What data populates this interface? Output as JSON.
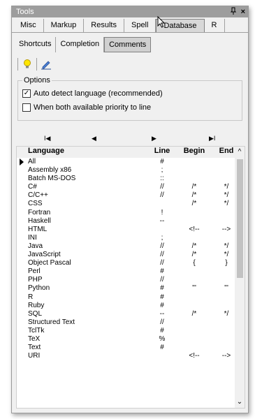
{
  "window": {
    "title": "Tools",
    "pin": "⵽",
    "close": "×"
  },
  "tabs": [
    {
      "label": "Misc",
      "active": false
    },
    {
      "label": "Markup",
      "active": false
    },
    {
      "label": "Results",
      "active": false
    },
    {
      "label": "Spell",
      "active": false
    },
    {
      "label": "Database",
      "active": true
    },
    {
      "label": "R",
      "active": false
    }
  ],
  "subtabs": [
    {
      "label": "Shortcuts",
      "active": false
    },
    {
      "label": "Completion",
      "active": false
    },
    {
      "label": "Comments",
      "active": true
    }
  ],
  "toolbar": {
    "icons": [
      "lightbulb-icon",
      "edit-pencil-icon"
    ]
  },
  "options": {
    "legend": "Options",
    "auto_detect": {
      "label": "Auto detect language (recommended)",
      "checked": true
    },
    "priority_line": {
      "label": "When both available priority to line",
      "checked": false
    }
  },
  "nav": {
    "first": "I◀",
    "prev": "◀",
    "next": "▶",
    "last": "▶I"
  },
  "grid": {
    "headers": {
      "language": "Language",
      "line": "Line",
      "begin": "Begin",
      "end": "End"
    },
    "rows": [
      {
        "language": "All",
        "line": "#",
        "begin": "",
        "end": "",
        "current": true
      },
      {
        "language": "Assembly x86",
        "line": ";",
        "begin": "",
        "end": ""
      },
      {
        "language": "Batch MS-DOS",
        "line": "::",
        "begin": "",
        "end": ""
      },
      {
        "language": "C#",
        "line": "//",
        "begin": "/*",
        "end": "*/"
      },
      {
        "language": "C/C++",
        "line": "//",
        "begin": "/*",
        "end": "*/"
      },
      {
        "language": "CSS",
        "line": "",
        "begin": "/*",
        "end": "*/"
      },
      {
        "language": "Fortran",
        "line": "!",
        "begin": "",
        "end": ""
      },
      {
        "language": "Haskell",
        "line": "--",
        "begin": "",
        "end": ""
      },
      {
        "language": "HTML",
        "line": "",
        "begin": "<!--",
        "end": "-->"
      },
      {
        "language": "INI",
        "line": ";",
        "begin": "",
        "end": ""
      },
      {
        "language": "Java",
        "line": "//",
        "begin": "/*",
        "end": "*/"
      },
      {
        "language": "JavaScript",
        "line": "//",
        "begin": "/*",
        "end": "*/"
      },
      {
        "language": "Object Pascal",
        "line": "//",
        "begin": "{",
        "end": "}"
      },
      {
        "language": "Perl",
        "line": "#",
        "begin": "",
        "end": ""
      },
      {
        "language": "PHP",
        "line": "//",
        "begin": "",
        "end": ""
      },
      {
        "language": "Python",
        "line": "#",
        "begin": "'''",
        "end": "'''"
      },
      {
        "language": "R",
        "line": "#",
        "begin": "",
        "end": ""
      },
      {
        "language": "Ruby",
        "line": "#",
        "begin": "",
        "end": ""
      },
      {
        "language": "SQL",
        "line": "--",
        "begin": "/*",
        "end": "*/"
      },
      {
        "language": "Structured Text",
        "line": "//",
        "begin": "",
        "end": ""
      },
      {
        "language": "TclTk",
        "line": "#",
        "begin": "",
        "end": ""
      },
      {
        "language": "TeX",
        "line": "%",
        "begin": "",
        "end": ""
      },
      {
        "language": "Text",
        "line": "#",
        "begin": "",
        "end": ""
      },
      {
        "language": "URI",
        "line": "",
        "begin": "<!--",
        "end": "-->"
      }
    ]
  },
  "colors": {
    "titlebar": "#9d9d9d",
    "active_tab": "#d8d8d8",
    "scroll_thumb": "#c2c2c2"
  }
}
